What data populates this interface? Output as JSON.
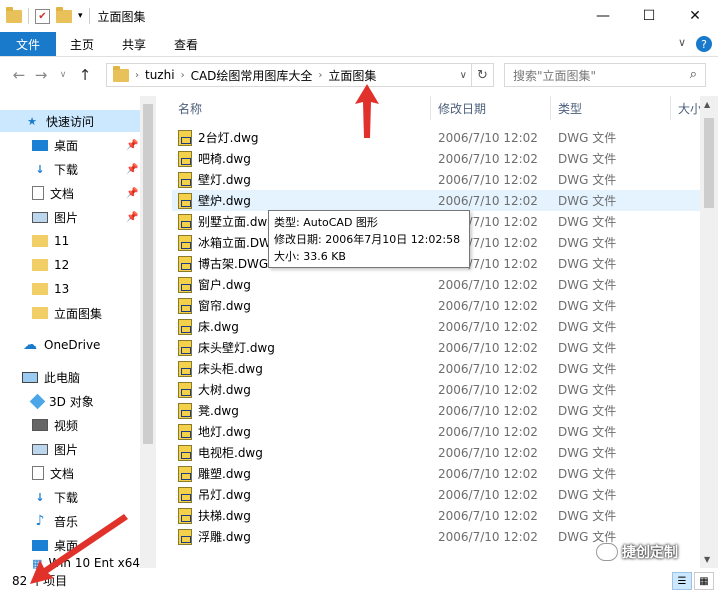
{
  "window": {
    "title": "立面图集",
    "minimize": "—",
    "maximize": "☐",
    "close": "✕"
  },
  "ribbon": {
    "tabs": [
      "文件",
      "主页",
      "共享",
      "查看"
    ],
    "expand": "∨",
    "help": "?"
  },
  "address": {
    "segments": [
      "tuzhi",
      "CAD绘图常用图库大全",
      "立面图集"
    ],
    "search_placeholder": "搜索\"立面图集\""
  },
  "nav": {
    "quick_access": "快速访问",
    "quick_items": [
      "桌面",
      "下载",
      "文档",
      "图片",
      "11",
      "12",
      "13",
      "立面图集"
    ],
    "onedrive": "OneDrive",
    "this_pc": "此电脑",
    "pc_items": [
      "3D 对象",
      "视频",
      "图片",
      "文档",
      "下载",
      "音乐",
      "桌面",
      "Win 10 Ent x64"
    ]
  },
  "columns": {
    "name": "名称",
    "date": "修改日期",
    "type": "类型",
    "size": "大小"
  },
  "files": [
    {
      "name": "2台灯.dwg",
      "date": "2006/7/10 12:02",
      "type": "DWG 文件"
    },
    {
      "name": "吧椅.dwg",
      "date": "2006/7/10 12:02",
      "type": "DWG 文件"
    },
    {
      "name": "壁灯.dwg",
      "date": "2006/7/10 12:02",
      "type": "DWG 文件"
    },
    {
      "name": "壁炉.dwg",
      "date": "2006/7/10 12:02",
      "type": "DWG 文件"
    },
    {
      "name": "别墅立面.dwg",
      "date": "2006/7/10 12:02",
      "type": "DWG 文件"
    },
    {
      "name": "冰箱立面.DWG",
      "date": "2006/7/10 12:02",
      "type": "DWG 文件"
    },
    {
      "name": "博古架.DWG",
      "date": "2006/7/10 12:02",
      "type": "DWG 文件"
    },
    {
      "name": "窗户.dwg",
      "date": "2006/7/10 12:02",
      "type": "DWG 文件"
    },
    {
      "name": "窗帘.dwg",
      "date": "2006/7/10 12:02",
      "type": "DWG 文件"
    },
    {
      "name": "床.dwg",
      "date": "2006/7/10 12:02",
      "type": "DWG 文件"
    },
    {
      "name": "床头壁灯.dwg",
      "date": "2006/7/10 12:02",
      "type": "DWG 文件"
    },
    {
      "name": "床头柜.dwg",
      "date": "2006/7/10 12:02",
      "type": "DWG 文件"
    },
    {
      "name": "大树.dwg",
      "date": "2006/7/10 12:02",
      "type": "DWG 文件"
    },
    {
      "name": "凳.dwg",
      "date": "2006/7/10 12:02",
      "type": "DWG 文件"
    },
    {
      "name": "地灯.dwg",
      "date": "2006/7/10 12:02",
      "type": "DWG 文件"
    },
    {
      "name": "电视柜.dwg",
      "date": "2006/7/10 12:02",
      "type": "DWG 文件"
    },
    {
      "name": "雕塑.dwg",
      "date": "2006/7/10 12:02",
      "type": "DWG 文件"
    },
    {
      "name": "吊灯.dwg",
      "date": "2006/7/10 12:02",
      "type": "DWG 文件"
    },
    {
      "name": "扶梯.dwg",
      "date": "2006/7/10 12:02",
      "type": "DWG 文件"
    },
    {
      "name": "浮雕.dwg",
      "date": "2006/7/10 12:02",
      "type": "DWG 文件"
    }
  ],
  "tooltip": {
    "type_line": "类型: AutoCAD 图形",
    "date_line": "修改日期: 2006年7月10日 12:02:58",
    "size_line": "大小: 33.6 KB"
  },
  "status": {
    "count": "82 个项目"
  },
  "watermark": {
    "text": "捷创定制"
  },
  "colors": {
    "accent": "#1979ca",
    "selection": "#cce8ff",
    "hover": "#e5f3ff",
    "arrow": "#e0322a"
  }
}
